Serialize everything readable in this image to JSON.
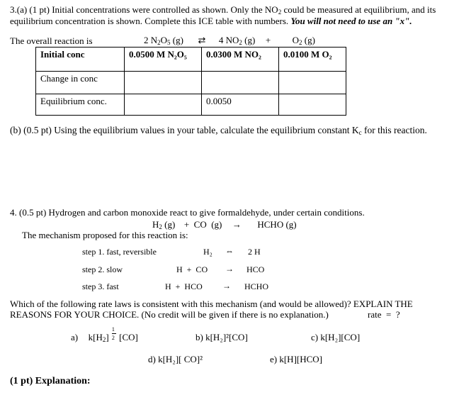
{
  "q3": {
    "intro_line1_a": "3.(a) (1 pt) Initial concentrations were controlled as shown. Only the NO",
    "intro_line1_sub": "2",
    "intro_line1_b": " could be measured at equilibrium, and its",
    "intro_line2_a": "equilibrium concentration is shown. Complete this ICE table with numbers. ",
    "intro_line2_emph": "You will not need to use an \"x\".",
    "reaction_label": "The overall reaction is",
    "reaction": {
      "reactant_coef": "2 N",
      "reactant_sub1": "2",
      "reactant_mid": "O",
      "reactant_sub2": "5",
      "reactant_state": " (g)",
      "arrow": "⇄",
      "product1_a": "4 NO",
      "product1_sub": "2",
      "product1_state": " (g)",
      "plus": "+",
      "product2_a": "O",
      "product2_sub": "2",
      "product2_state": " (g)"
    },
    "ice_table": {
      "rows": [
        {
          "label": "Initial conc",
          "cells": [
            "0.0500 M N₂O₅",
            "0.0300 M NO₂",
            "0.0100 M O₂"
          ]
        },
        {
          "label": "Change in conc",
          "cells": [
            "",
            "",
            ""
          ]
        },
        {
          "label": "Equilibrium conc.",
          "cells": [
            "",
            "0.0050",
            ""
          ]
        }
      ]
    },
    "part_b": "(b)  (0.5 pt) Using the equilibrium values in your table, calculate the equilibrium constant K",
    "part_b_sub": "c",
    "part_b_end": " for this reaction."
  },
  "q4": {
    "intro": "4. (0.5 pt) Hydrogen and carbon monoxide react to give formaldehyde, under certain conditions.",
    "overall": {
      "h2": "H",
      "h2_sub": "2",
      "h2_state": " (g)",
      "plus": "+  CO  (g)",
      "arrow": "→",
      "product": "HCHO (g)"
    },
    "mechanism_label": "The mechanism proposed for this reaction is:",
    "steps": [
      {
        "label": "step 1.  fast, reversible",
        "reactants": "H₂",
        "arrow": "⇔",
        "products": "2 H"
      },
      {
        "label": "step 2.  slow",
        "reactants": "H  +  CO",
        "arrow": "→",
        "products": "HCO"
      },
      {
        "label": "step 3. fast",
        "reactants": "H  +  HCO",
        "arrow": "→",
        "products": "HCHO"
      }
    ],
    "question_line1": "Which of the following rate laws is consistent with this mechanism (and would be allowed)?  EXPLAIN THE",
    "question_line2": "REASONS FOR YOUR CHOICE. (No credit will be given if there is no explanation.)",
    "rate_prompt": "rate  =  ?",
    "options": {
      "a_label": "a)",
      "a_expr_pre": "k[H",
      "a_sub": "2",
      "a_close": "]",
      "a_frac_num": "1",
      "a_frac_den": "2",
      "a_post": " [CO]",
      "b": "b)  k[H₂]²[CO]",
      "c": "c) k[H₂][CO]",
      "d": "d)  k[H₂][ CO]²",
      "e": "e)  k[H][HCO]"
    },
    "explanation_label": "(1 pt) Explanation:"
  }
}
